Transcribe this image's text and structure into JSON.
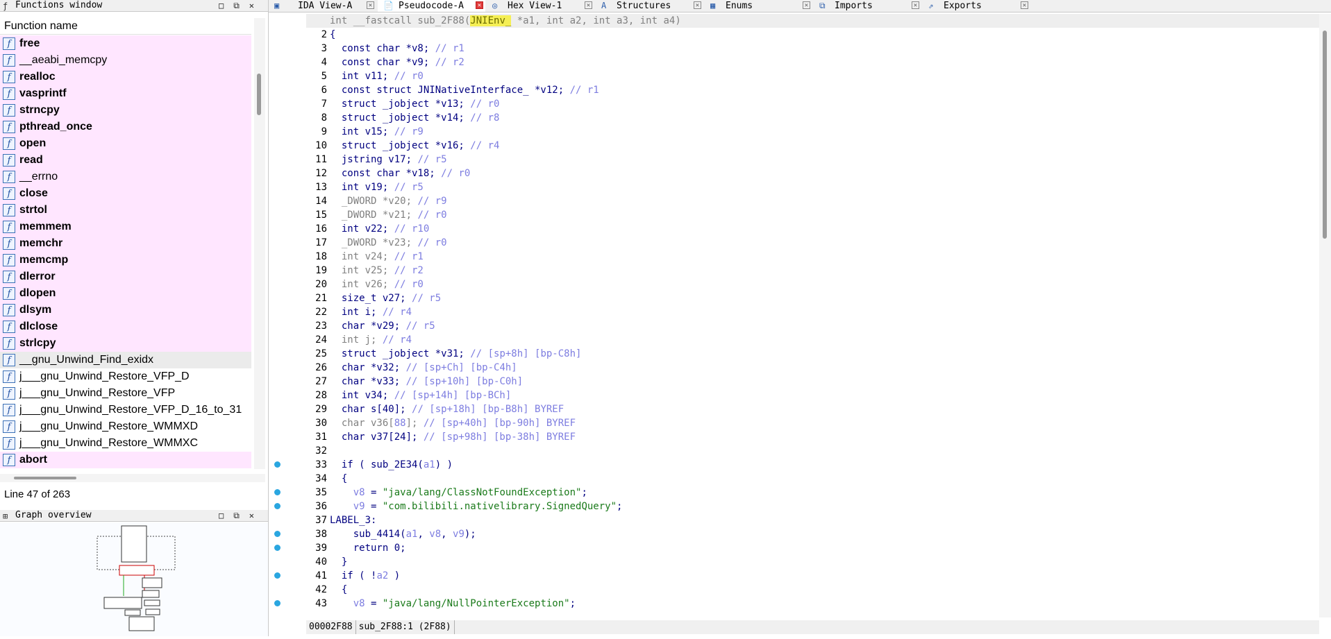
{
  "functions_window": {
    "title": "Functions window",
    "column_header": "Function name",
    "items": [
      {
        "name": "free",
        "library": true,
        "bold": true
      },
      {
        "name": "__aeabi_memcpy",
        "library": true,
        "bold": false
      },
      {
        "name": "realloc",
        "library": true,
        "bold": true
      },
      {
        "name": "vasprintf",
        "library": true,
        "bold": true
      },
      {
        "name": "strncpy",
        "library": true,
        "bold": true
      },
      {
        "name": "pthread_once",
        "library": true,
        "bold": true
      },
      {
        "name": "open",
        "library": true,
        "bold": true
      },
      {
        "name": "read",
        "library": true,
        "bold": true
      },
      {
        "name": "__errno",
        "library": true,
        "bold": false
      },
      {
        "name": "close",
        "library": true,
        "bold": true
      },
      {
        "name": "strtol",
        "library": true,
        "bold": true
      },
      {
        "name": "memmem",
        "library": true,
        "bold": true
      },
      {
        "name": "memchr",
        "library": true,
        "bold": true
      },
      {
        "name": "memcmp",
        "library": true,
        "bold": true
      },
      {
        "name": "dlerror",
        "library": true,
        "bold": true
      },
      {
        "name": "dlopen",
        "library": true,
        "bold": true
      },
      {
        "name": "dlsym",
        "library": true,
        "bold": true
      },
      {
        "name": "dlclose",
        "library": true,
        "bold": true
      },
      {
        "name": "strlcpy",
        "library": true,
        "bold": true
      },
      {
        "name": "__gnu_Unwind_Find_exidx",
        "library": false,
        "bold": false,
        "selected": true
      },
      {
        "name": "j___gnu_Unwind_Restore_VFP_D",
        "library": false,
        "bold": false
      },
      {
        "name": "j___gnu_Unwind_Restore_VFP",
        "library": false,
        "bold": false
      },
      {
        "name": "j___gnu_Unwind_Restore_VFP_D_16_to_31",
        "library": false,
        "bold": false
      },
      {
        "name": "j___gnu_Unwind_Restore_WMMXD",
        "library": false,
        "bold": false
      },
      {
        "name": "j___gnu_Unwind_Restore_WMMXC",
        "library": false,
        "bold": false
      },
      {
        "name": "abort",
        "library": true,
        "bold": true
      }
    ],
    "status": "Line 47 of 263"
  },
  "graph_overview": {
    "title": "Graph overview"
  },
  "tabs": [
    {
      "label": "IDA View-A",
      "icon": "ida-view-icon",
      "active": false
    },
    {
      "label": "Pseudocode-A",
      "icon": "pseudocode-icon",
      "active": true
    },
    {
      "label": "Hex View-1",
      "icon": "hex-view-icon",
      "active": false
    },
    {
      "label": "Structures",
      "icon": "structures-icon",
      "active": false
    },
    {
      "label": "Enums",
      "icon": "enums-icon",
      "active": false
    },
    {
      "label": "Imports",
      "icon": "imports-icon",
      "active": false
    },
    {
      "label": "Exports",
      "icon": "exports-icon",
      "active": false
    }
  ],
  "code_lines": [
    [
      [
        "gry",
        "int __fastcall sub_2F88("
      ],
      [
        "hiw",
        "JNIEnv_"
      ],
      [
        "gry",
        " *a1, int a2, int a3, int a4)"
      ]
    ],
    [
      [
        "",
        "{"
      ]
    ],
    [
      [
        "",
        "  const char *v8; "
      ],
      [
        "cm",
        "// r1"
      ]
    ],
    [
      [
        "",
        "  const char *v9; "
      ],
      [
        "cm",
        "// r2"
      ]
    ],
    [
      [
        "",
        "  int v11; "
      ],
      [
        "cm",
        "// r0"
      ]
    ],
    [
      [
        "",
        "  const struct JNINativeInterface_ *v12; "
      ],
      [
        "cm",
        "// r1"
      ]
    ],
    [
      [
        "",
        "  struct _jobject *v13; "
      ],
      [
        "cm",
        "// r0"
      ]
    ],
    [
      [
        "",
        "  struct _jobject *v14; "
      ],
      [
        "cm",
        "// r8"
      ]
    ],
    [
      [
        "",
        "  int v15; "
      ],
      [
        "cm",
        "// r9"
      ]
    ],
    [
      [
        "",
        "  struct _jobject *v16; "
      ],
      [
        "cm",
        "// r4"
      ]
    ],
    [
      [
        "",
        "  jstring v17; "
      ],
      [
        "cm",
        "// r5"
      ]
    ],
    [
      [
        "",
        "  const char *v18; "
      ],
      [
        "cm",
        "// r0"
      ]
    ],
    [
      [
        "",
        "  int v19; "
      ],
      [
        "cm",
        "// r5"
      ]
    ],
    [
      [
        "gry",
        "  _DWORD *v20; "
      ],
      [
        "cm",
        "// r9"
      ]
    ],
    [
      [
        "gry",
        "  _DWORD *v21; "
      ],
      [
        "cm",
        "// r0"
      ]
    ],
    [
      [
        "",
        "  int v22; "
      ],
      [
        "cm",
        "// r10"
      ]
    ],
    [
      [
        "gry",
        "  _DWORD *v23; "
      ],
      [
        "cm",
        "// r0"
      ]
    ],
    [
      [
        "gry",
        "  int v24; "
      ],
      [
        "cm",
        "// r1"
      ]
    ],
    [
      [
        "gry",
        "  int v25; "
      ],
      [
        "cm",
        "// r2"
      ]
    ],
    [
      [
        "gry",
        "  int v26; "
      ],
      [
        "cm",
        "// r0"
      ]
    ],
    [
      [
        "",
        "  size_t v27; "
      ],
      [
        "cm",
        "// r5"
      ]
    ],
    [
      [
        "",
        "  int i; "
      ],
      [
        "cm",
        "// r4"
      ]
    ],
    [
      [
        "",
        "  char *v29; "
      ],
      [
        "cm",
        "// r5"
      ]
    ],
    [
      [
        "gry",
        "  int j; "
      ],
      [
        "cm",
        "// r4"
      ]
    ],
    [
      [
        "",
        "  struct _jobject *v31; "
      ],
      [
        "cm",
        "// [sp+8h] [bp-C8h]"
      ]
    ],
    [
      [
        "",
        "  char *v32; "
      ],
      [
        "cm",
        "// [sp+Ch] [bp-C4h]"
      ]
    ],
    [
      [
        "",
        "  char *v33; "
      ],
      [
        "cm",
        "// [sp+10h] [bp-C0h]"
      ]
    ],
    [
      [
        "",
        "  int v34; "
      ],
      [
        "cm",
        "// [sp+14h] [bp-BCh]"
      ]
    ],
    [
      [
        "",
        "  char s[40]; "
      ],
      [
        "cm",
        "// [sp+18h] [bp-B8h] BYREF"
      ]
    ],
    [
      [
        "gry",
        "  char v36["
      ],
      [
        "cm",
        "88"
      ],
      [
        "gry",
        "]; "
      ],
      [
        "cm",
        "// [sp+40h] [bp-90h] BYREF"
      ]
    ],
    [
      [
        "",
        "  char v37[24]; "
      ],
      [
        "cm",
        "// [sp+98h] [bp-38h] BYREF"
      ]
    ],
    [
      [
        "",
        ""
      ]
    ],
    [
      [
        "",
        "  if ( sub_2E34("
      ],
      [
        "cm",
        "a1"
      ],
      [
        "",
        ") )"
      ]
    ],
    [
      [
        "",
        "  {"
      ]
    ],
    [
      [
        "",
        "    "
      ],
      [
        "cm",
        "v8"
      ],
      [
        "",
        " = "
      ],
      [
        "str",
        "\"java/lang/ClassNotFoundException\""
      ],
      [
        "",
        ";"
      ]
    ],
    [
      [
        "",
        "    "
      ],
      [
        "cm",
        "v9"
      ],
      [
        "",
        " = "
      ],
      [
        "str",
        "\"com.bilibili.nativelibrary.SignedQuery\""
      ],
      [
        "",
        ";"
      ]
    ],
    [
      [
        "",
        "LABEL_3:"
      ]
    ],
    [
      [
        "",
        "    sub_4414("
      ],
      [
        "cm",
        "a1"
      ],
      [
        "",
        ", "
      ],
      [
        "cm",
        "v8"
      ],
      [
        "",
        ", "
      ],
      [
        "cm",
        "v9"
      ],
      [
        "",
        ");"
      ]
    ],
    [
      [
        "",
        "    return 0;"
      ]
    ],
    [
      [
        "",
        "  }"
      ]
    ],
    [
      [
        "",
        "  if ( !"
      ],
      [
        "cm",
        "a2"
      ],
      [
        "",
        " )"
      ]
    ],
    [
      [
        "",
        "  {"
      ]
    ],
    [
      [
        "",
        "    "
      ],
      [
        "cm",
        "v8"
      ],
      [
        "",
        " = "
      ],
      [
        "str",
        "\"java/lang/NullPointerException\""
      ],
      [
        "",
        ";"
      ]
    ]
  ],
  "breakpoint_lines": [
    33,
    35,
    36,
    38,
    39,
    41,
    43
  ],
  "status_bar": {
    "address": "00002F88",
    "location": "sub_2F88:1 (2F88)"
  }
}
